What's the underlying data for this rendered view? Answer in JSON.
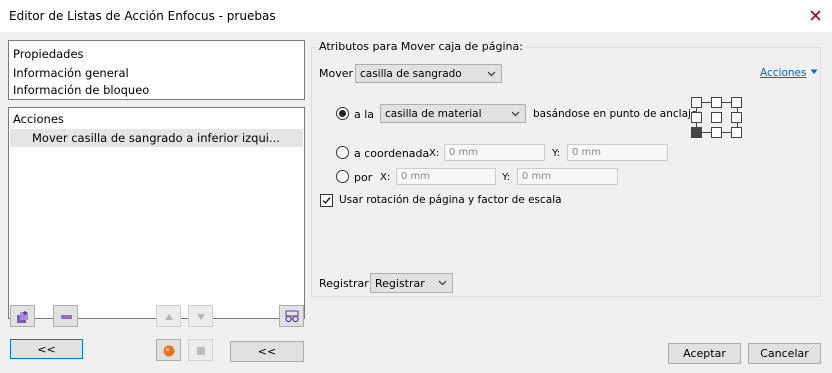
{
  "window": {
    "title": "Editor de Listas de Acción Enfocus - pruebas"
  },
  "left": {
    "properties": {
      "header": "Propiedades",
      "items": [
        "Información general",
        "Información de bloqueo"
      ]
    },
    "actions": {
      "header": "Acciones",
      "selected_item": "Mover casilla de sangrado a inferior izqui..."
    },
    "collapse_label": "<<",
    "collapse_label_2": "<<"
  },
  "right": {
    "group_title": "Atributos para Mover caja de página:",
    "move_label": "Mover",
    "move_value": "casilla de sangrado",
    "actions_link": "Acciones",
    "radio_to": {
      "label": "a la",
      "box_value": "casilla de material",
      "suffix": "basándose en punto de anclaje:",
      "selected": true
    },
    "radio_coord": {
      "label": "a coordenada",
      "x_label": "X:",
      "x_value": "0 mm",
      "y_label": "Y:",
      "y_value": "0 mm"
    },
    "radio_by": {
      "label": "por",
      "x_label": "X:",
      "x_value": "0 mm",
      "y_label": "Y:",
      "y_value": "0 mm"
    },
    "checkbox": {
      "label": "Usar rotación de página y factor de escala",
      "checked": true
    },
    "register_label": "Registrar",
    "register_value": "Registrar",
    "anchor": {
      "selected": "bottom-left"
    }
  },
  "footer": {
    "accept": "Aceptar",
    "cancel": "Cancelar"
  },
  "colors": {
    "accent": "#0078d7",
    "link": "#0066cc",
    "selection": "#e5e5e5",
    "record": "#e8731a"
  }
}
